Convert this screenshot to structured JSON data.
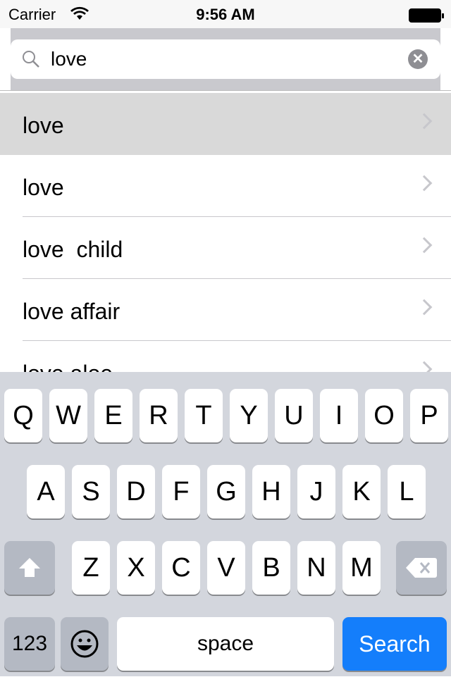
{
  "status": {
    "carrier": "Carrier",
    "time": "9:56 AM"
  },
  "search": {
    "value": "love"
  },
  "results": [
    "love",
    "love",
    "love  child",
    "love affair",
    "love aloe"
  ],
  "keyboard": {
    "row1": [
      "Q",
      "W",
      "E",
      "R",
      "T",
      "Y",
      "U",
      "I",
      "O",
      "P"
    ],
    "row2": [
      "A",
      "S",
      "D",
      "F",
      "G",
      "H",
      "J",
      "K",
      "L"
    ],
    "row3": [
      "Z",
      "X",
      "C",
      "V",
      "B",
      "N",
      "M"
    ],
    "numbers": "123",
    "space": "space",
    "search": "Search"
  },
  "colors": {
    "accent": "#147efb",
    "selected_row": "#d9d9d9",
    "keyboard_bg": "#d3d6dd"
  }
}
